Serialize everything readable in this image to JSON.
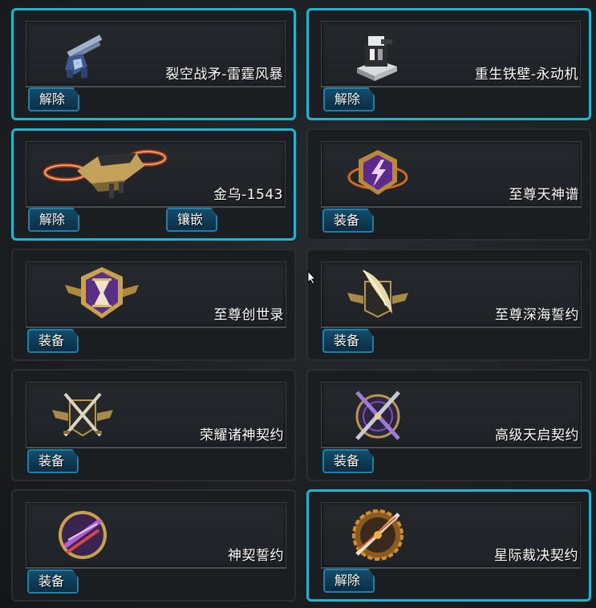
{
  "colors": {
    "selected_border": "#1fb4cf",
    "button_fill": "#134d6b",
    "button_border": "#1e7fa8"
  },
  "items": [
    {
      "name": "裂空战矛-雷霆风暴",
      "icon": "blue-mech-cannon-icon",
      "selected": true,
      "buttons": [
        "解除"
      ]
    },
    {
      "name": "重生铁壁-永动机",
      "icon": "white-black-turret-icon",
      "selected": true,
      "buttons": [
        "解除"
      ]
    },
    {
      "name": "金乌-1543",
      "icon": "golden-drone-icon",
      "selected": true,
      "buttons": [
        "解除",
        "镶嵌"
      ]
    },
    {
      "name": "至尊天神谱",
      "icon": "purple-lightning-emblem-icon",
      "selected": false,
      "buttons": [
        "装备"
      ]
    },
    {
      "name": "至尊创世录",
      "icon": "hourglass-emblem-icon",
      "selected": false,
      "buttons": [
        "装备"
      ]
    },
    {
      "name": "至尊深海誓约",
      "icon": "gold-blade-emblem-icon",
      "selected": false,
      "buttons": [
        "装备"
      ]
    },
    {
      "name": "荣耀诸神契约",
      "icon": "crossed-swords-emblem-icon",
      "selected": false,
      "buttons": [
        "装备"
      ]
    },
    {
      "name": "高级天启契约",
      "icon": "purple-crossed-swords-emblem-icon",
      "selected": false,
      "buttons": [
        "装备"
      ]
    },
    {
      "name": "神契誓约",
      "icon": "purple-weapons-medallion-icon",
      "selected": false,
      "buttons": [
        "装备"
      ]
    },
    {
      "name": "星际裁决契约",
      "icon": "gear-sword-medallion-icon",
      "selected": true,
      "buttons": [
        "解除"
      ]
    }
  ]
}
